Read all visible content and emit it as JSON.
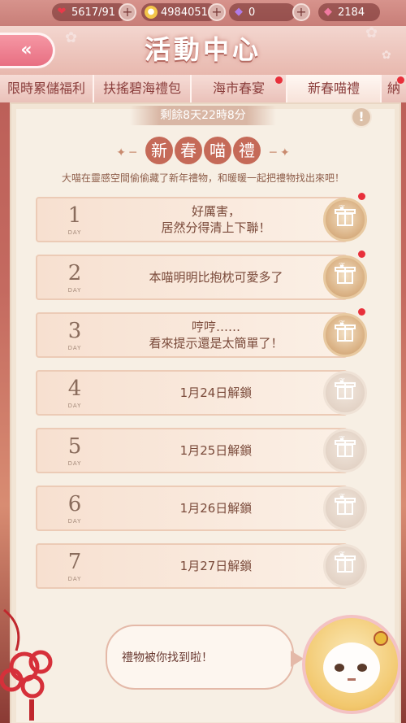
{
  "resources": [
    {
      "icon": "heart-icon",
      "glyph": "❤",
      "value": "5617/91",
      "color": "#e83a4a"
    },
    {
      "icon": "cat-coin-icon",
      "glyph": "🐱",
      "value": "4984051",
      "color": "#f3c64a"
    },
    {
      "icon": "diamond-icon",
      "glyph": "◆",
      "value": "0",
      "color": "#b07be6"
    },
    {
      "icon": "pink-diamond-icon",
      "glyph": "◆",
      "value": "2184",
      "color": "#f07aa0"
    }
  ],
  "header": {
    "back_icon": "double-chevron-left-icon",
    "back_glyph": "«",
    "title": "活動中心"
  },
  "tabs": [
    {
      "label": "限時累儲福利",
      "active": false,
      "dot": false
    },
    {
      "label": "扶搖碧海禮包",
      "active": false,
      "dot": false
    },
    {
      "label": "海市春宴",
      "active": false,
      "dot": true
    },
    {
      "label": "新春喵禮",
      "active": true,
      "dot": false
    },
    {
      "label": "納",
      "active": false,
      "dot": true
    }
  ],
  "event": {
    "timer": "剩餘8天22時8分",
    "info_glyph": "!",
    "title_chars": [
      "新",
      "春",
      "喵",
      "禮"
    ],
    "description": "大喵在靈感空間偷偷藏了新年禮物，和暖暖一起把禮物找出來吧！",
    "day_label": "DAY"
  },
  "days": [
    {
      "num": "1",
      "text": "好厲害，\n居然分得清上下聯！",
      "unlocked": true,
      "dot": true
    },
    {
      "num": "2",
      "text": "本喵明明比抱枕可愛多了",
      "unlocked": true,
      "dot": true
    },
    {
      "num": "3",
      "text": "哼哼……\n看來提示還是太簡單了！",
      "unlocked": true,
      "dot": true
    },
    {
      "num": "4",
      "text": "1月24日解鎖",
      "unlocked": false,
      "dot": false
    },
    {
      "num": "5",
      "text": "1月25日解鎖",
      "unlocked": false,
      "dot": false
    },
    {
      "num": "6",
      "text": "1月26日解鎖",
      "unlocked": false,
      "dot": false
    },
    {
      "num": "7",
      "text": "1月27日解鎖",
      "unlocked": false,
      "dot": false
    }
  ],
  "dialog": {
    "text": "禮物被你找到啦！"
  },
  "colors": {
    "accent": "#c56a58",
    "notify": "#e8303b",
    "panel": "#f7efe4"
  }
}
